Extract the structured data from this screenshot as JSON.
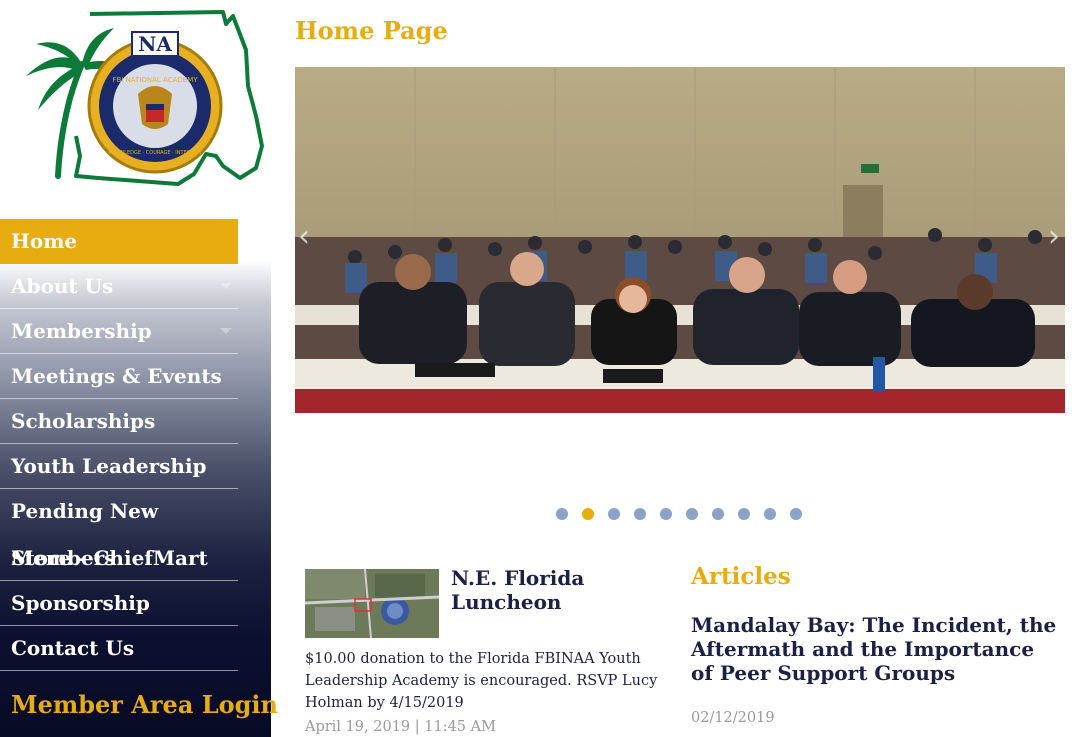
{
  "sidebar": {
    "logo": {
      "badge_top": "NA",
      "badge_ring": "FBI NATIONAL ACADEMY",
      "badge_motto": "KNOWLEDGE · COURAGE · INTEGRITY"
    },
    "nav": [
      {
        "label": "Home",
        "active": true
      },
      {
        "label": "About Us",
        "has_dropdown": true
      },
      {
        "label": "Membership",
        "has_dropdown": true
      },
      {
        "label": "Meetings & Events"
      },
      {
        "label": "Scholarships"
      },
      {
        "label": "Youth Leadership"
      },
      {
        "label": "Pending New"
      },
      {
        "label": "Members",
        "overlap": "Store - ChiefMart"
      },
      {
        "label": "Sponsorship"
      },
      {
        "label": "Contact Us"
      }
    ],
    "member_login": "Member Area Login"
  },
  "main": {
    "page_title": "Home Page",
    "carousel": {
      "slide_count": 10,
      "active_index": 1
    },
    "event": {
      "title": "N.E. Florida Luncheon",
      "description": "$10.00 donation to the Florida FBINAA Youth Leadership Academy is encouraged. RSVP Lucy Holman by 4/15/2019",
      "date": "April 19, 2019 | 11:45 AM"
    },
    "articles": {
      "heading": "Articles",
      "title": "Mandalay Bay: The Incident, the Aftermath and the Importance of Peer Support Groups",
      "date": "02/12/2019"
    }
  },
  "colors": {
    "accent_gold": "#e6ac10",
    "navy_text": "#1b2146",
    "dot_blue": "#8ba2c8",
    "muted_date": "#9a9a9a"
  }
}
